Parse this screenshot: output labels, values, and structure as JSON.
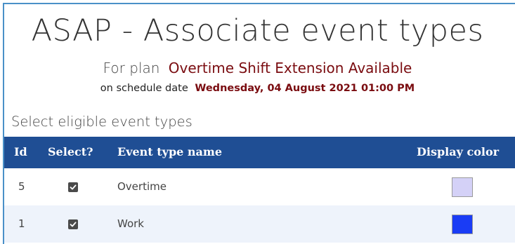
{
  "header": {
    "title": "ASAP - Associate event types",
    "plan_prefix": "For plan",
    "plan_name": "Overtime Shift Extension Available",
    "date_prefix": "on schedule date",
    "date_value": "Wednesday, 04 August 2021 01:00 PM"
  },
  "section": {
    "label": "Select eligible event types"
  },
  "table": {
    "columns": [
      "Id",
      "Select?",
      "Event type name",
      "Display color"
    ],
    "rows": [
      {
        "id": "5",
        "selected": true,
        "name": "Overtime",
        "color": "#d4d1f7"
      },
      {
        "id": "1",
        "selected": true,
        "name": "Work",
        "color": "#1a3cf5"
      }
    ]
  }
}
